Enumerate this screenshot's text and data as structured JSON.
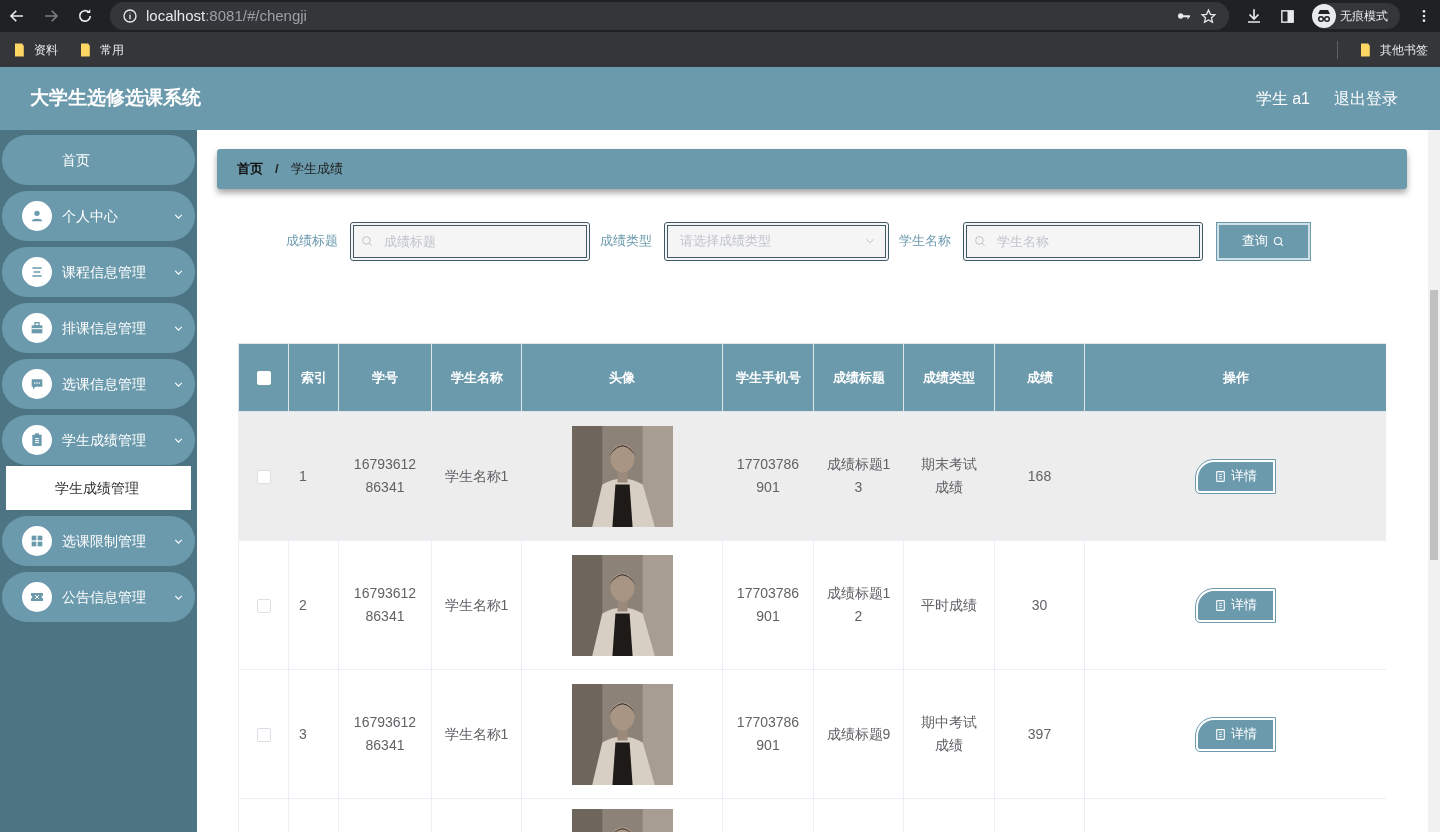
{
  "browser": {
    "url_host": "localhost",
    "url_rest": ":8081/#/chengji",
    "incognito_label": "无痕模式",
    "bookmarks": [
      "资料",
      "常用"
    ],
    "other_bookmarks": "其他书签"
  },
  "header": {
    "title": "大学生选修选课系统",
    "user": "学生 a1",
    "logout": "退出登录"
  },
  "sidebar": {
    "items": [
      {
        "label": "首页",
        "kind": "plain"
      },
      {
        "label": "个人中心",
        "kind": "menu"
      },
      {
        "label": "课程信息管理",
        "kind": "menu"
      },
      {
        "label": "排课信息管理",
        "kind": "menu"
      },
      {
        "label": "选课信息管理",
        "kind": "menu"
      },
      {
        "label": "学生成绩管理",
        "kind": "menu",
        "children": [
          {
            "label": "学生成绩管理",
            "selected": true
          }
        ]
      },
      {
        "label": "选课限制管理",
        "kind": "menu"
      },
      {
        "label": "公告信息管理",
        "kind": "menu"
      }
    ]
  },
  "breadcrumb": [
    "首页",
    "学生成绩"
  ],
  "breadcrumb_separator": "/",
  "filters": [
    {
      "label": "成绩标题",
      "placeholder": "成绩标题",
      "kind": "text"
    },
    {
      "label": "成绩类型",
      "placeholder": "请选择成绩类型",
      "kind": "select"
    },
    {
      "label": "学生名称",
      "placeholder": "学生名称",
      "kind": "text"
    }
  ],
  "search_button": "查询",
  "table": {
    "select_all_checked": false,
    "columns": [
      "索引",
      "学号",
      "学生名称",
      "头像",
      "学生手机号",
      "成绩标题",
      "成绩类型",
      "成绩",
      "操作"
    ],
    "rows": [
      {
        "checked": false,
        "hover": true,
        "index": "1",
        "student_no": "1679361286341",
        "name": "学生名称1",
        "phone": "17703786901",
        "title": "成绩标题13",
        "type": "期末考试成绩",
        "score": "168",
        "action": "详情"
      },
      {
        "checked": false,
        "hover": false,
        "index": "2",
        "student_no": "1679361286341",
        "name": "学生名称1",
        "phone": "17703786901",
        "title": "成绩标题12",
        "type": "平时成绩",
        "score": "30",
        "action": "详情"
      },
      {
        "checked": false,
        "hover": false,
        "index": "3",
        "student_no": "1679361286341",
        "name": "学生名称1",
        "phone": "17703786901",
        "title": "成绩标题9",
        "type": "期中考试成绩",
        "score": "397",
        "action": "详情"
      }
    ]
  }
}
